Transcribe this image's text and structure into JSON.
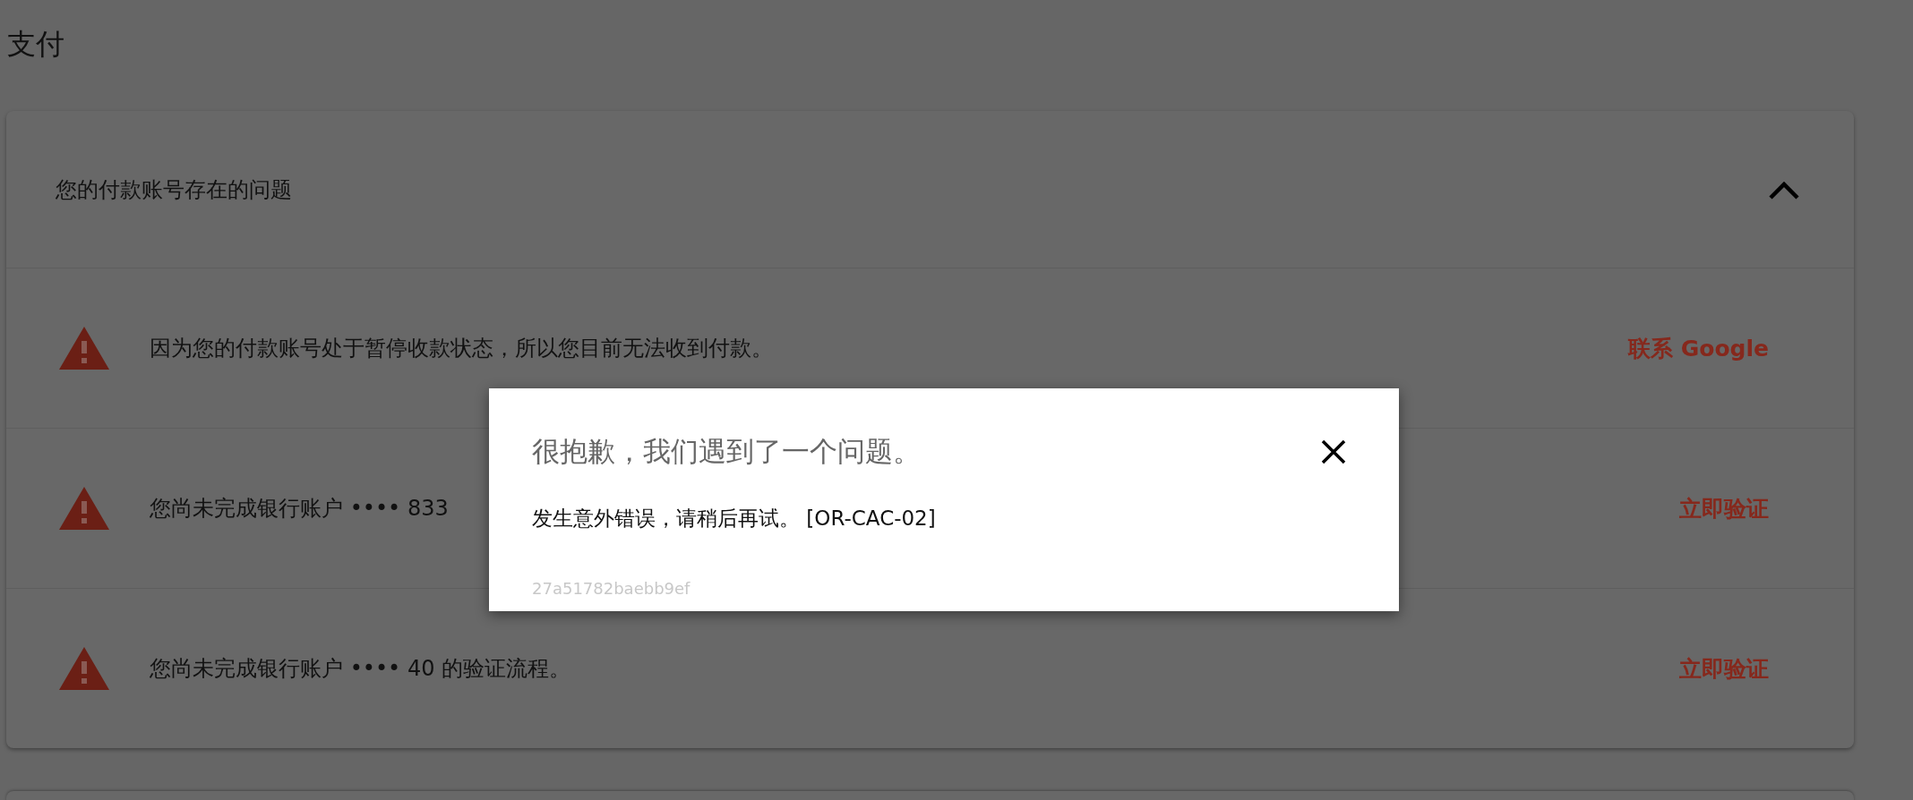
{
  "page_title": "支付",
  "issues_panel": {
    "title": "您的付款账号存在的问题",
    "expanded": true,
    "items": [
      {
        "message": "因为您的付款账号处于暂停收款状态，所以您目前无法收到付款。",
        "action": "联系 Google"
      },
      {
        "message": "您尚未完成银行账户 •••• 833",
        "action": "立即验证"
      },
      {
        "message": "您尚未完成银行账户 •••• 40 的验证流程。",
        "action": "立即验证"
      }
    ]
  },
  "dialog": {
    "title": "很抱歉，我们遇到了一个问题。",
    "message": "发生意外错误，请稍后再试。 [OR-CAC-02]",
    "error_id": "27a51782baebb9ef"
  }
}
